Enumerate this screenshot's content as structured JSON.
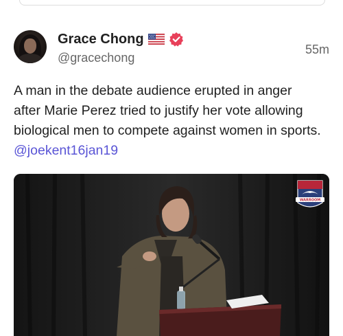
{
  "author": {
    "name": "Grace Chong",
    "handle": "@gracechong",
    "flag_icon": "us-flag-icon",
    "verified_icon": "verified-badge-icon",
    "verified_color": "#e8405a"
  },
  "post": {
    "time": "55m",
    "text": "A man in the debate audience erupted in anger after Marie Perez tried to justify her vote allowing biological men to compete against women in sports. ",
    "mention": "@joekent16jan19",
    "mention_color": "#5a55d6"
  },
  "media": {
    "watermark": "WARROOM"
  }
}
